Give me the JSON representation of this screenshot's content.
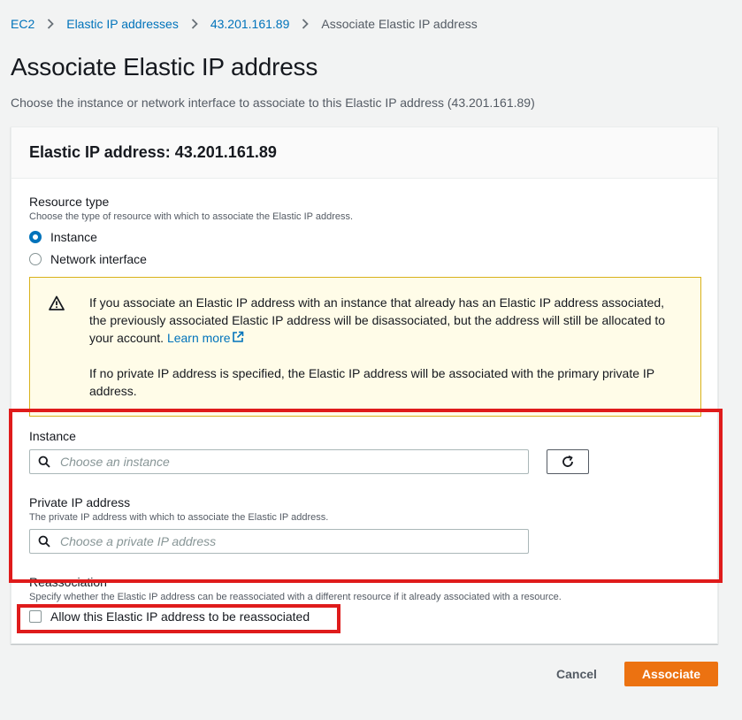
{
  "breadcrumb": {
    "items": [
      "EC2",
      "Elastic IP addresses",
      "43.201.161.89"
    ],
    "current": "Associate Elastic IP address"
  },
  "page": {
    "title": "Associate Elastic IP address",
    "description": "Choose the instance or network interface to associate to this Elastic IP address (43.201.161.89)"
  },
  "panel": {
    "title": "Elastic IP address: 43.201.161.89"
  },
  "resource_type": {
    "label": "Resource type",
    "hint": "Choose the type of resource with which to associate the Elastic IP address.",
    "options": [
      "Instance",
      "Network interface"
    ],
    "selected": "Instance"
  },
  "warning": {
    "text1": "If you associate an Elastic IP address with an instance that already has an Elastic IP address associated, the previously associated Elastic IP address will be disassociated, but the address will still be allocated to your account. ",
    "link": "Learn more",
    "text2": "If no private IP address is specified, the Elastic IP address will be associated with the primary private IP address."
  },
  "instance": {
    "label": "Instance",
    "placeholder": "Choose an instance"
  },
  "private_ip": {
    "label": "Private IP address",
    "hint": "The private IP address with which to associate the Elastic IP address.",
    "placeholder": "Choose a private IP address"
  },
  "reassociation": {
    "label": "Reassociation",
    "hint": "Specify whether the Elastic IP address can be reassociated with a different resource if it already associated with a resource.",
    "checkbox_label": "Allow this Elastic IP address to be reassociated",
    "checked": false
  },
  "actions": {
    "cancel": "Cancel",
    "associate": "Associate"
  },
  "colors": {
    "link": "#0073bb",
    "primary": "#ec7211",
    "warning_bg": "#fffce8",
    "warning_border": "#d8b21b",
    "annotation": "#df1b1b"
  }
}
